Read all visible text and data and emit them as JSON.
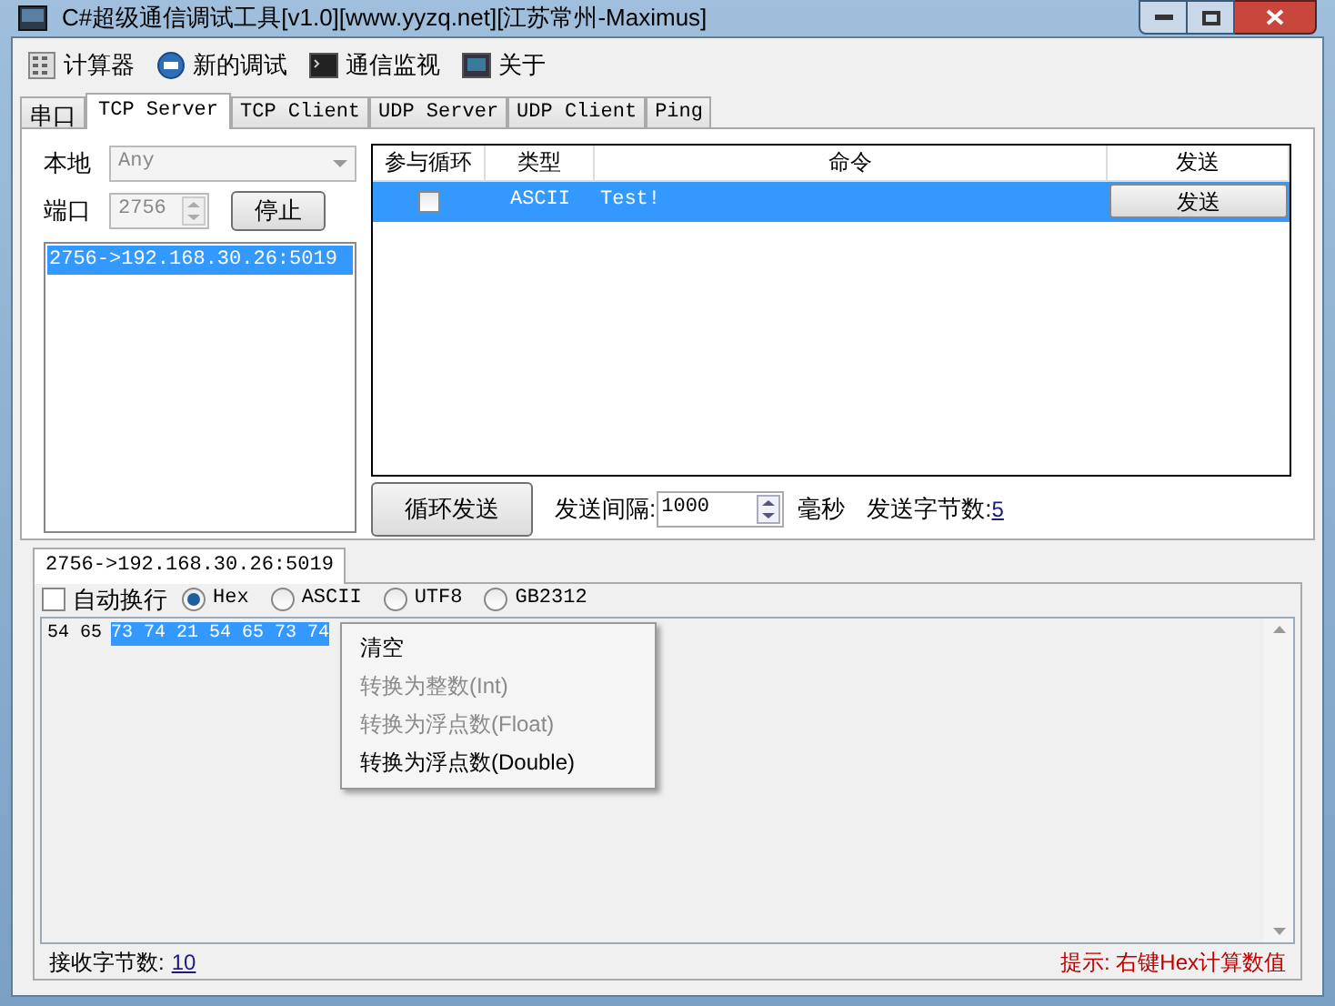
{
  "window": {
    "title": "C#超级通信调试工具[v1.0][www.yyzq.net][江苏常州-Maximus]"
  },
  "toolbar": [
    {
      "label": "计算器"
    },
    {
      "label": "新的调试"
    },
    {
      "label": "通信监视"
    },
    {
      "label": "关于"
    }
  ],
  "tabs": [
    {
      "label": "串口",
      "selected": false
    },
    {
      "label": "TCP Server",
      "selected": true
    },
    {
      "label": "TCP Client",
      "selected": false
    },
    {
      "label": "UDP Server",
      "selected": false
    },
    {
      "label": "UDP Client",
      "selected": false
    },
    {
      "label": "Ping",
      "selected": false
    }
  ],
  "server": {
    "local_label": "本地",
    "local_value": "Any",
    "port_label": "端口",
    "port_value": "2756",
    "stop_button": "停止",
    "connections": [
      {
        "label": "2756->192.168.30.26:5019",
        "selected": true
      }
    ]
  },
  "command_table": {
    "columns": [
      "参与循环",
      "类型",
      "命令",
      "发送"
    ],
    "rows": [
      {
        "loop": false,
        "type": "ASCII",
        "command": "Test!",
        "send_button": "发送",
        "selected": true
      }
    ]
  },
  "loop_send_button": "循环发送",
  "interval_label": "发送间隔:",
  "interval_value": "1000",
  "interval_unit": "毫秒",
  "send_bytes_label": "发送字节数:",
  "send_bytes_value": "5",
  "receive": {
    "tabs": [
      {
        "label": "2756->192.168.30.26:5019",
        "selected": true
      }
    ],
    "auto_wrap": {
      "label": "自动换行",
      "checked": false
    },
    "encodings": [
      {
        "label": "Hex",
        "selected": true
      },
      {
        "label": "ASCII",
        "selected": false
      },
      {
        "label": "UTF8",
        "selected": false
      },
      {
        "label": "GB2312",
        "selected": false
      }
    ],
    "output": {
      "text": "54 65",
      "selected_text": "73 74 21 54 65 73 74"
    },
    "receive_bytes_label": "接收字节数:",
    "receive_bytes_value": "10",
    "hint": "提示: 右键Hex计算数值"
  },
  "context_menu": [
    {
      "label": "清空",
      "disabled": false
    },
    {
      "label": "转换为整数(Int)",
      "disabled": true
    },
    {
      "label": "转换为浮点数(Float)",
      "disabled": true
    },
    {
      "label": "转换为浮点数(Double)",
      "disabled": false
    }
  ]
}
